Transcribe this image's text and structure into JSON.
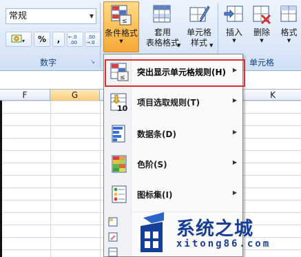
{
  "ribbon": {
    "number_group": {
      "format_value": "常规",
      "label": "数字",
      "currency_label": "▾",
      "percent_label": "%",
      "comma_label": ",",
      "inc_decimal_label": "←.0\n.00",
      "dec_decimal_label": ".00\n→.0"
    },
    "styles_group": {
      "conditional_format_label": "条件格式",
      "table_format_label": "套用\n表格格式",
      "cell_style_label": "单元格\n样式"
    },
    "cells_group": {
      "label": "单元格",
      "insert_label": "插入",
      "delete_label": "删除",
      "format_label": "格式"
    }
  },
  "sheet": {
    "columns": [
      "F",
      "G",
      "K"
    ],
    "active_column": "G"
  },
  "menu": {
    "items": [
      {
        "label": "突出显示单元格规则(H)",
        "icon": "highlight-rules-icon"
      },
      {
        "label": "项目选取规则(T)",
        "icon": "top-bottom-rules-icon"
      },
      {
        "label": "数据条(D)",
        "icon": "data-bars-icon"
      },
      {
        "label": "色阶(S)",
        "icon": "color-scales-icon"
      },
      {
        "label": "图标集(I)",
        "icon": "icon-sets-icon"
      }
    ],
    "highlight_color": "#d9302c"
  },
  "watermark": {
    "brand": "系统之城",
    "site": "xitong86.com"
  },
  "colors": {
    "ribbon_bg": "#dde9f8",
    "pressed_button": "#fbbf55",
    "watermark_blue": "#173e96"
  }
}
